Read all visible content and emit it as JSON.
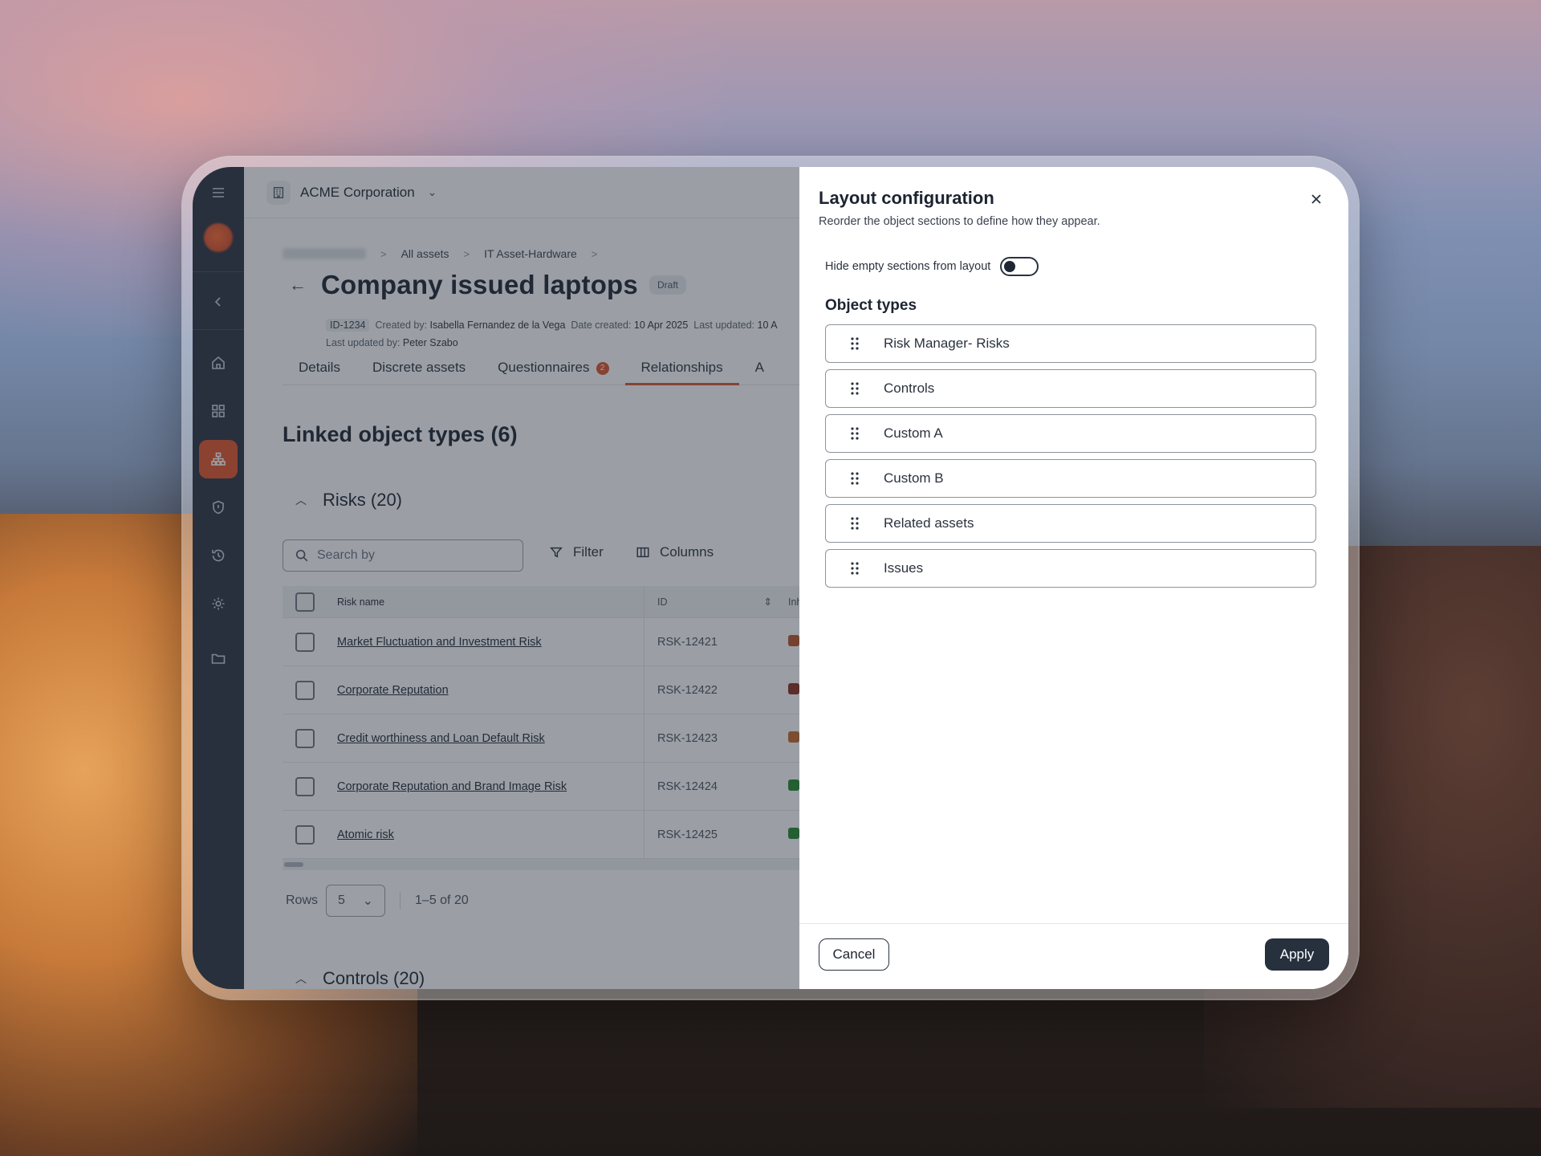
{
  "org": {
    "name": "ACME Corporation"
  },
  "breadcrumb": [
    "All assets",
    "IT Asset-Hardware"
  ],
  "page": {
    "title": "Company issued laptops",
    "status": "Draft",
    "meta": {
      "id": "ID-1234",
      "created_by_label": "Created by:",
      "created_by": "Isabella Fernandez de la Vega",
      "date_created_label": "Date created:",
      "date_created": "10 Apr 2025",
      "last_updated_label": "Last updated:",
      "last_updated": "10 A",
      "last_updated_by_label": "Last updated by:",
      "last_updated_by": "Peter Szabo"
    }
  },
  "tabs": [
    {
      "label": "Details"
    },
    {
      "label": "Discrete assets"
    },
    {
      "label": "Questionnaires",
      "count": "2"
    },
    {
      "label": "Relationships",
      "active": true
    },
    {
      "label": "A"
    }
  ],
  "linked": {
    "title": "Linked object types (6)"
  },
  "risks": {
    "title": "Risks (20)",
    "search_placeholder": "Search by",
    "filter_label": "Filter",
    "columns_label": "Columns",
    "headers": {
      "name": "Risk name",
      "id": "ID",
      "inh": "Inhe"
    },
    "rows": [
      {
        "name": "Market Fluctuation and Investment Risk",
        "id": "RSK-12421",
        "color": "#b8532a"
      },
      {
        "name": "Corporate Reputation",
        "id": "RSK-12422",
        "color": "#8a2f1c"
      },
      {
        "name": "Credit worthiness and Loan Default Risk",
        "id": "RSK-12423",
        "color": "#c46a2a"
      },
      {
        "name": "Corporate Reputation and Brand Image Risk",
        "id": "RSK-12424",
        "color": "#23892f"
      },
      {
        "name": "Atomic risk",
        "id": "RSK-12425",
        "color": "#23892f"
      }
    ],
    "pager": {
      "rows_label": "Rows",
      "rows_value": "5",
      "range": "1–5 of 20"
    }
  },
  "controls": {
    "title": "Controls (20)"
  },
  "drawer": {
    "title": "Layout configuration",
    "subtitle": "Reorder the object sections to define how they appear.",
    "toggle_label": "Hide empty sections from layout",
    "toggle_on": false,
    "object_types_title": "Object types",
    "items": [
      "Risk Manager- Risks",
      "Controls",
      "Custom A",
      "Custom B",
      "Related assets",
      "Issues"
    ],
    "cancel_label": "Cancel",
    "apply_label": "Apply"
  },
  "icons": {
    "sidebar": [
      "menu-icon",
      "chevron-left-icon",
      "home-icon",
      "grid-icon",
      "hierarchy-icon",
      "shield-icon",
      "history-icon",
      "gear-icon",
      "folder-icon"
    ],
    "accent": "#e1542a"
  }
}
